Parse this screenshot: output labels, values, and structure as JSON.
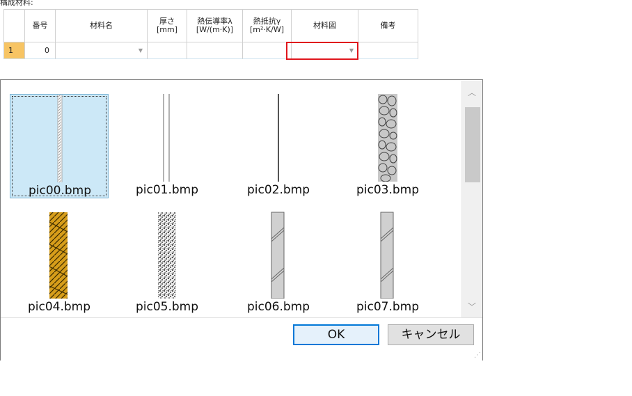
{
  "section_label": "構成材料:",
  "grid": {
    "headers": [
      "",
      "番号",
      "材料名",
      "厚さ\n[mm]",
      "熱伝導率λ\n[W/(m·K)]",
      "熱抵抗γ\n[m²·K/W]",
      "材料図",
      "備考"
    ],
    "row": {
      "index": "1",
      "number": "0",
      "material_name": "",
      "thickness": "",
      "conductivity": "",
      "resistance": "",
      "figure": "",
      "note": ""
    }
  },
  "picker": {
    "items": [
      {
        "label": "pic00.bmp",
        "selected": true,
        "pattern": "dashed-gap"
      },
      {
        "label": "pic01.bmp",
        "selected": false,
        "pattern": "double-line"
      },
      {
        "label": "pic02.bmp",
        "selected": false,
        "pattern": "single-line"
      },
      {
        "label": "pic03.bmp",
        "selected": false,
        "pattern": "gravel"
      },
      {
        "label": "pic04.bmp",
        "selected": false,
        "pattern": "wood-hatch"
      },
      {
        "label": "pic05.bmp",
        "selected": false,
        "pattern": "speckle"
      },
      {
        "label": "pic06.bmp",
        "selected": false,
        "pattern": "gray-diagonal"
      },
      {
        "label": "pic07.bmp",
        "selected": false,
        "pattern": "gray-diagonal"
      }
    ],
    "ok_label": "OK",
    "cancel_label": "キャンセル"
  },
  "colors": {
    "row_header": "#f7c463",
    "selection": "#cce8f7",
    "highlight_border": "#e0161d",
    "default_button": "#0078d7"
  }
}
